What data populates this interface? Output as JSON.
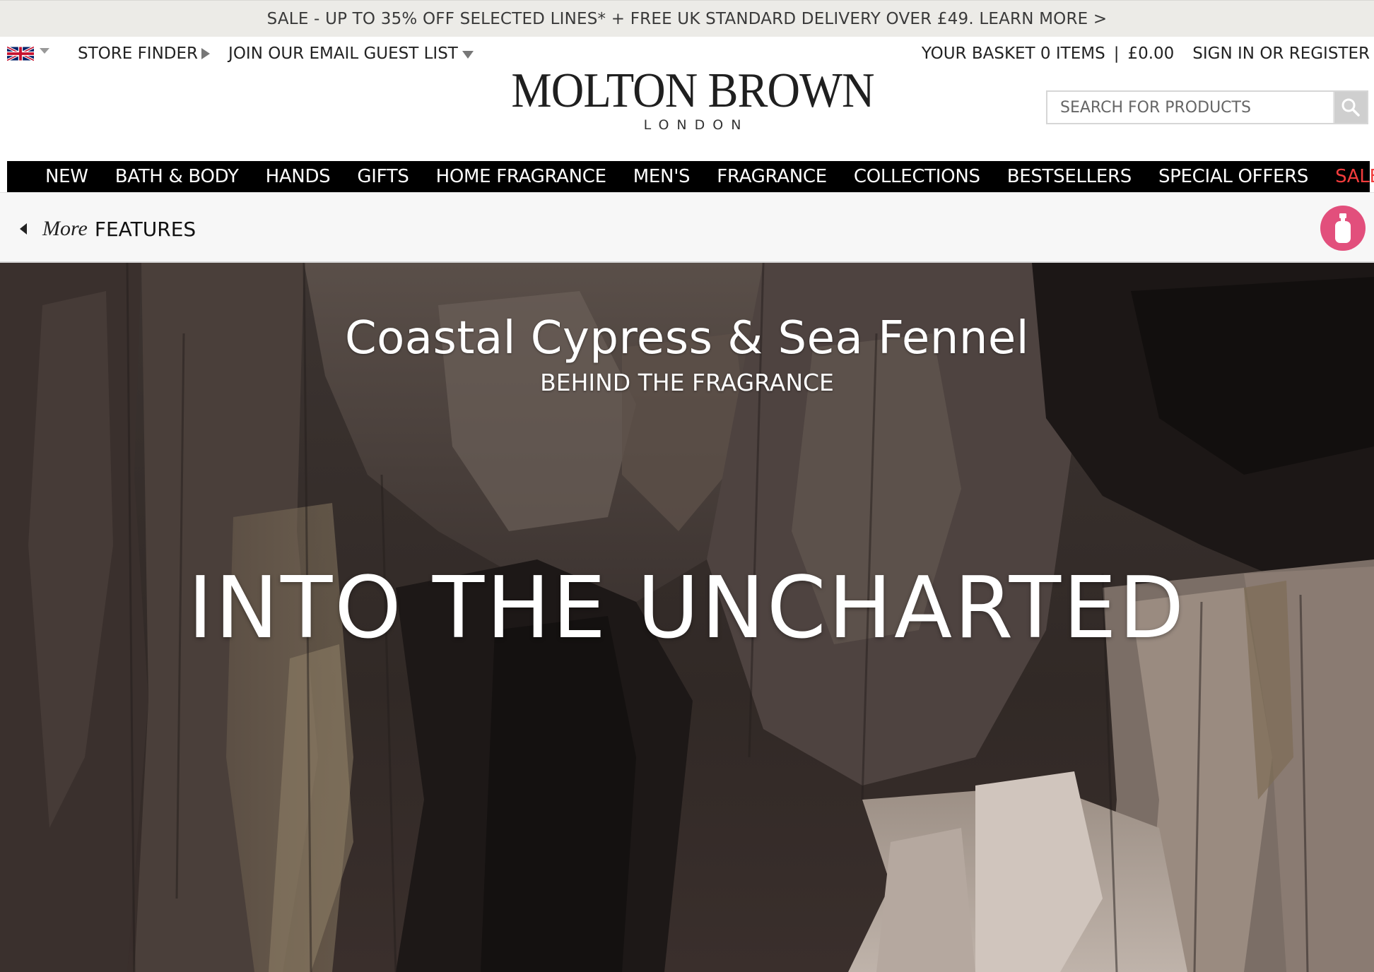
{
  "promo": {
    "text": "SALE - UP TO 35% OFF SELECTED LINES* + FREE UK STANDARD DELIVERY OVER £49. LEARN MORE >"
  },
  "utility": {
    "flag_icon": "uk-flag-icon",
    "store_finder": "STORE FINDER",
    "email_list": "JOIN OUR EMAIL GUEST LIST",
    "basket": "YOUR BASKET 0 ITEMS",
    "separator": "|",
    "basket_total": "£0.00",
    "sign_in": "SIGN IN OR REGISTER"
  },
  "logo": {
    "main": "MOLTON BROWN",
    "sub": "LONDON"
  },
  "search": {
    "placeholder": "SEARCH FOR PRODUCTS",
    "icon": "search-icon"
  },
  "nav": {
    "items": [
      {
        "label": "NEW"
      },
      {
        "label": "BATH & BODY"
      },
      {
        "label": "HANDS"
      },
      {
        "label": "GIFTS"
      },
      {
        "label": "HOME FRAGRANCE"
      },
      {
        "label": "MEN'S"
      },
      {
        "label": "FRAGRANCE"
      },
      {
        "label": "COLLECTIONS"
      },
      {
        "label": "BESTSELLERS"
      },
      {
        "label": "SPECIAL OFFERS"
      },
      {
        "label": "SALE"
      }
    ],
    "sale_color": "#f23c3c"
  },
  "features": {
    "more": "More",
    "label": "FEATURES",
    "bottle_icon": "bottle-icon",
    "bottle_color": "#e24f7c"
  },
  "hero": {
    "title": "Coastal Cypress & Sea Fennel",
    "subtitle": "BEHIND THE FRAGRANCE",
    "headline": "INTO THE UNCHARTED"
  }
}
